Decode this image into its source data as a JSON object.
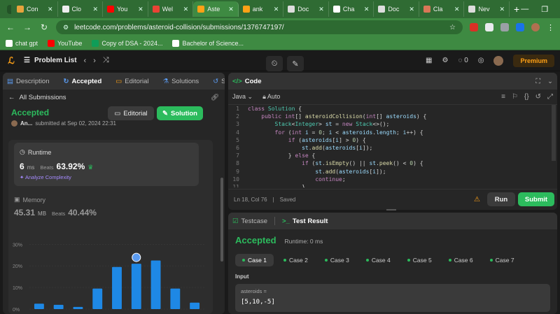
{
  "browser": {
    "tabs": [
      {
        "label": "Con",
        "color": "#e8a33d",
        "icon": "chart-icon"
      },
      {
        "label": "Clo",
        "color": "#eeeeee",
        "icon": "page-icon"
      },
      {
        "label": "You",
        "color": "#ff0000",
        "icon": "youtube-icon"
      },
      {
        "label": "Wel",
        "color": "#ea4335",
        "icon": "gmail-icon"
      },
      {
        "label": "Aste",
        "color": "#ffa116",
        "icon": "leetcode-icon"
      },
      {
        "label": "ank",
        "color": "#ffa116",
        "icon": "leetcode-icon"
      },
      {
        "label": "Doc",
        "color": "#dddddd",
        "icon": "globe-icon"
      },
      {
        "label": "Cha",
        "color": "#ffffff",
        "icon": "chatgpt-icon"
      },
      {
        "label": "Doc",
        "color": "#dddddd",
        "icon": "globe-icon"
      },
      {
        "label": "Cla",
        "color": "#d97757",
        "icon": "claude-icon"
      },
      {
        "label": "Nev",
        "color": "#dddddd",
        "icon": "chrome-icon"
      }
    ],
    "url": "leetcode.com/problems/asteroid-collision/submissions/1376747197/",
    "bookmarks": [
      {
        "label": "chat gpt",
        "color": "#ffffff"
      },
      {
        "label": "YouTube",
        "color": "#ff0000"
      },
      {
        "label": "Copy of DSA - 2024...",
        "color": "#0f9d58"
      },
      {
        "label": "Bachelor of Science...",
        "color": "#ffffff"
      }
    ]
  },
  "header": {
    "title": "Problem List",
    "fire_count": "0",
    "premium": "Premium"
  },
  "left_panel": {
    "tabs": [
      {
        "label": "Description",
        "active": false
      },
      {
        "label": "Accepted",
        "active": true
      },
      {
        "label": "Editorial",
        "active": false
      },
      {
        "label": "Solutions",
        "active": false
      },
      {
        "label": "Submiss",
        "active": false
      }
    ],
    "all_submissions": "All Submissions",
    "status": "Accepted",
    "author": "An...",
    "submitted_at": "submitted at Sep 02, 2024 22:31",
    "editorial_btn": "Editorial",
    "solution_btn": "Solution",
    "runtime": {
      "label": "Runtime",
      "value": "6",
      "unit": "ms",
      "beats_label": "Beats",
      "beats": "63.92%",
      "analyze": "Analyze Complexity"
    },
    "memory": {
      "label": "Memory",
      "value": "45.31",
      "unit": "MB",
      "beats_label": "Beats",
      "beats": "40.44%"
    }
  },
  "chart_data": {
    "type": "bar",
    "yticks": [
      "30%",
      "20%",
      "10%",
      "0%"
    ],
    "ylim": [
      0,
      33
    ],
    "values": [
      2.5,
      2,
      1,
      9.5,
      19.5,
      21,
      22.5,
      9.5,
      3
    ],
    "highlight_index": 5,
    "color": "#1e88e5"
  },
  "code_panel": {
    "title": "Code",
    "language": "Java",
    "mode": "Auto",
    "status": "Ln 18, Col 76",
    "saved": "Saved",
    "run": "Run",
    "submit": "Submit",
    "lines": [
      {
        "n": "1",
        "t": "class Solution {"
      },
      {
        "n": "2",
        "t": "    public int[] asteroidCollision(int[] asteroids) {"
      },
      {
        "n": "3",
        "t": "        Stack<Integer> st = new Stack<>();"
      },
      {
        "n": "4",
        "t": "        for (int i = 0; i < asteroids.length; i++) {"
      },
      {
        "n": "5",
        "t": "            if (asteroids[i] > 0) {"
      },
      {
        "n": "6",
        "t": "                st.add(asteroids[i]);"
      },
      {
        "n": "7",
        "t": "            } else {"
      },
      {
        "n": "8",
        "t": "                if (st.isEmpty() || st.peek() < 0) {"
      },
      {
        "n": "9",
        "t": "                    st.add(asteroids[i]);"
      },
      {
        "n": "10",
        "t": "                    continue;"
      },
      {
        "n": "11",
        "t": "                }"
      }
    ]
  },
  "test_panel": {
    "tab_testcase": "Testcase",
    "tab_result": "Test Result",
    "result": "Accepted",
    "runtime": "Runtime: 0 ms",
    "cases": [
      "Case 1",
      "Case 2",
      "Case 3",
      "Case 4",
      "Case 5",
      "Case 6",
      "Case 7"
    ],
    "input_label": "Input",
    "input_name": "asteroids =",
    "input_value": "[5,10,-5]"
  }
}
